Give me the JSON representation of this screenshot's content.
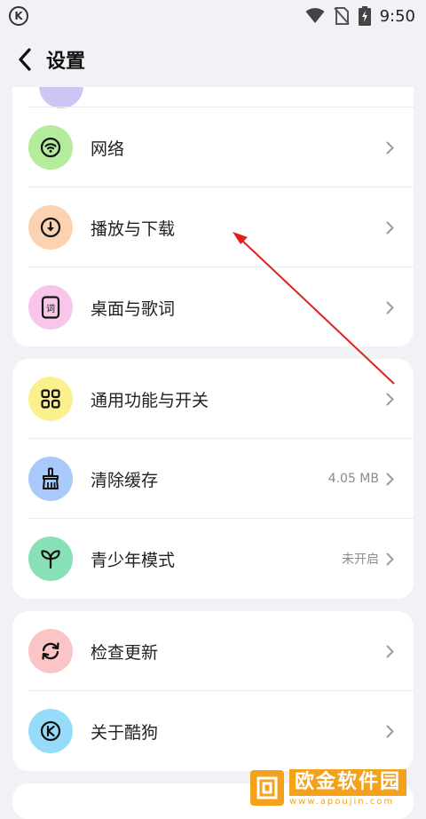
{
  "status_bar": {
    "time": "9:50",
    "app_logo_letter": "K"
  },
  "header": {
    "title": "设置"
  },
  "groups": [
    {
      "items": [
        {
          "label": "网络",
          "value": "",
          "icon": "wifi-icon",
          "color": "#b4ec9c"
        },
        {
          "label": "播放与下载",
          "value": "",
          "icon": "download-circle-icon",
          "color": "#fcd3b2"
        },
        {
          "label": "桌面与歌词",
          "value": "",
          "icon": "lyrics-widget-icon",
          "color": "#f8c6ea"
        }
      ]
    },
    {
      "items": [
        {
          "label": "通用功能与开关",
          "value": "",
          "icon": "grid-icon",
          "color": "#fbf08e"
        },
        {
          "label": "清除缓存",
          "value": "4.05 MB",
          "icon": "broom-icon",
          "color": "#a9c9fb"
        },
        {
          "label": "青少年模式",
          "value": "未开启",
          "icon": "sprout-icon",
          "color": "#87e0b6"
        }
      ]
    },
    {
      "items": [
        {
          "label": "检查更新",
          "value": "",
          "icon": "refresh-icon",
          "color": "#fbc5c6"
        },
        {
          "label": "关于酷狗",
          "value": "",
          "icon": "kugou-logo-icon",
          "color": "#97dbfb"
        }
      ]
    }
  ],
  "watermark": {
    "text": "欧金软件园",
    "url": "www.apoujin.com"
  },
  "colors": {
    "background": "#f1f2f6",
    "card": "#ffffff",
    "annotation_arrow": "#e02020",
    "watermark": "#f4a21c"
  }
}
